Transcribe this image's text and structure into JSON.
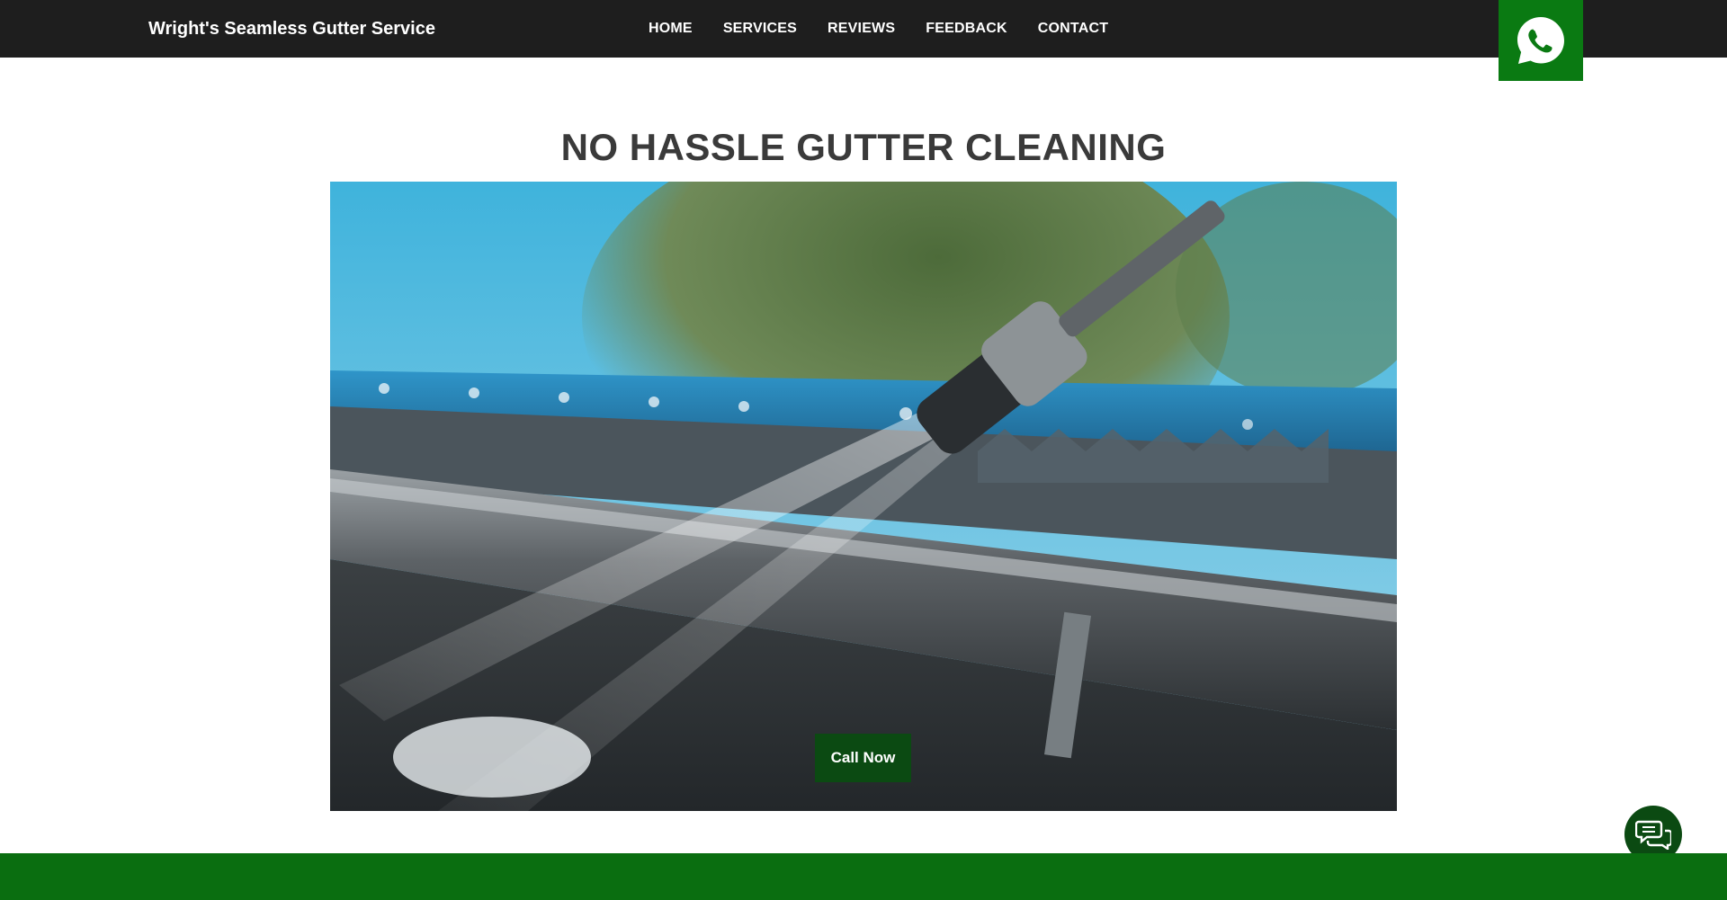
{
  "header": {
    "brand": "Wright's Seamless Gutter Service",
    "nav": [
      {
        "label": "HOME"
      },
      {
        "label": "SERVICES"
      },
      {
        "label": "REVIEWS"
      },
      {
        "label": "FEEDBACK"
      },
      {
        "label": "CONTACT"
      }
    ],
    "whatsapp_icon": "whatsapp-icon"
  },
  "hero": {
    "headline": "NO HASSLE GUTTER CLEANING",
    "image_subject": "pressure washer cleaning a roof gutter",
    "call_button": "Call Now"
  },
  "chat": {
    "icon": "chat-bubbles-icon"
  },
  "colors": {
    "topbar": "#1e1e1e",
    "accent_green": "#0a7a12",
    "dark_green": "#0b4a12",
    "headline": "#3a3a3a"
  }
}
